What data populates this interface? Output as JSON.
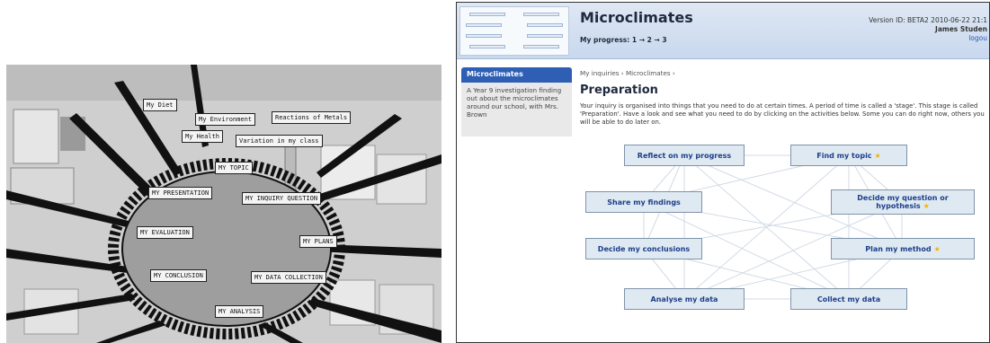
{
  "photo": {
    "inner_signs": [
      "MY TOPIC",
      "MY PRESENTATION",
      "MY INQUIRY QUESTION",
      "MY EVALUATION",
      "MY PLANS",
      "MY CONCLUSION",
      "MY DATA COLLECTION",
      "MY ANALYSIS"
    ],
    "outer_signs": [
      "My Diet",
      "My Environment",
      "Reactions of Metals",
      "My Health",
      "Variation in my class"
    ]
  },
  "app": {
    "title": "Microclimates",
    "progress": "My progress: 1 → 2 → 3",
    "version": "Version ID: BETA2 2010-06-22 21:1",
    "user": "James Studen",
    "logout": "logou"
  },
  "sidebar": {
    "title": "Microclimates",
    "description": "A Year 9 investigation finding out about the microclimates around our school, with Mrs. Brown"
  },
  "main": {
    "breadcrumb": "My inquiries › Microclimates ›",
    "page_title": "Preparation",
    "intro": "Your inquiry is organised into things that you need to do at certain times. A period of time is called a 'stage'. This stage is called 'Preparation'. Have a look and see what you need to do by clicking on the activities below. Some you can do right now, others you will be able to do later on."
  },
  "activities": [
    {
      "label": "Reflect on my progress",
      "starred": false
    },
    {
      "label": "Find my topic",
      "starred": true
    },
    {
      "label": "Share my findings",
      "starred": false
    },
    {
      "label": "Decide my question or hypothesis",
      "starred": true
    },
    {
      "label": "Decide my conclusions",
      "starred": false
    },
    {
      "label": "Plan my method",
      "starred": true
    },
    {
      "label": "Analyse my data",
      "starred": false
    },
    {
      "label": "Collect my data",
      "starred": false
    }
  ],
  "icons": {
    "star": "star-icon"
  },
  "colors": {
    "accent": "#2f5fb4",
    "activity_bg": "#dfe9f2",
    "activity_text": "#1d3f8a",
    "star": "#f1b400"
  }
}
